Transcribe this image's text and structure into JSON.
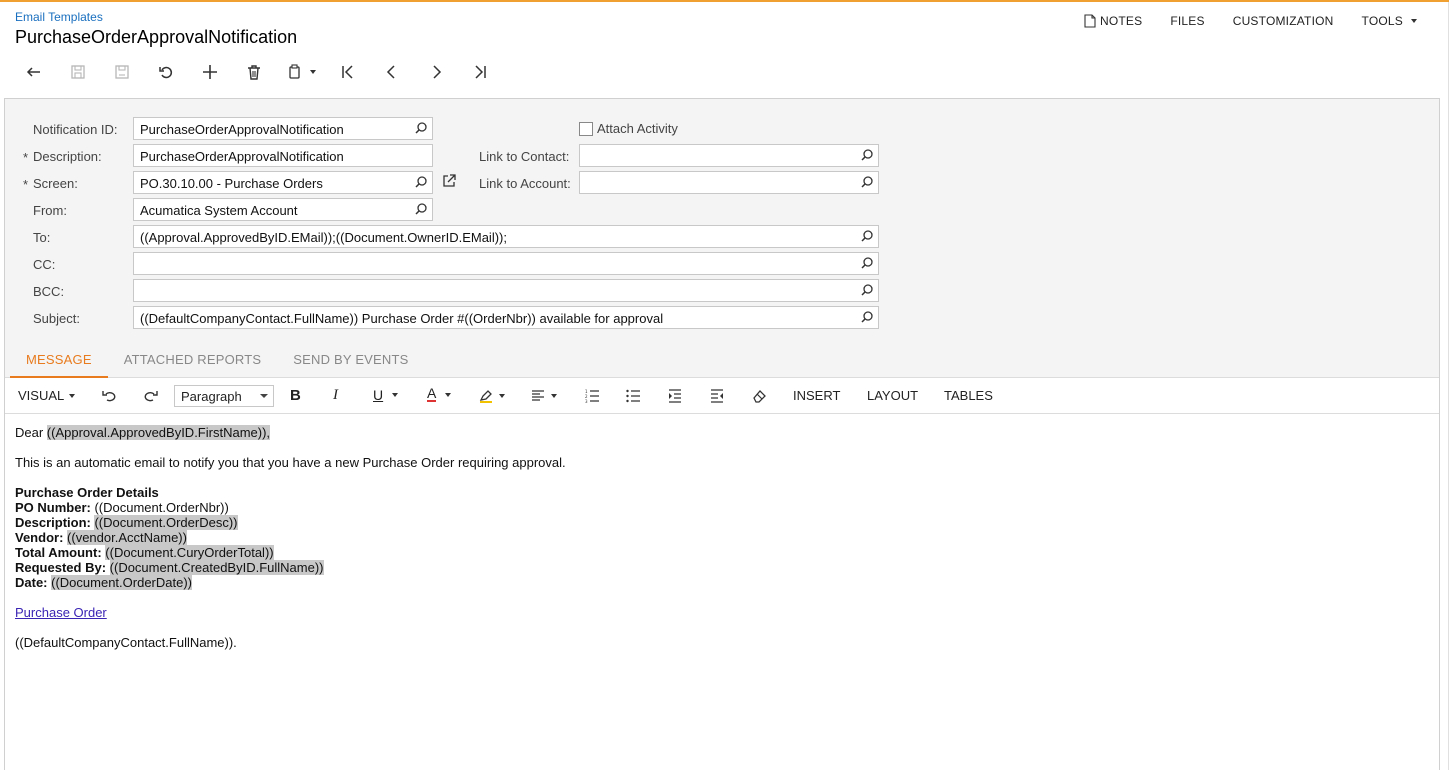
{
  "breadcrumb": "Email Templates",
  "page_title": "PurchaseOrderApprovalNotification",
  "top_menu": {
    "notes": "NOTES",
    "files": "FILES",
    "customization": "CUSTOMIZATION",
    "tools": "TOOLS"
  },
  "toolbar_icons": [
    "back-icon",
    "save-close-icon",
    "save-icon",
    "undo-icon",
    "add-icon",
    "delete-icon",
    "copy-paste-icon",
    "first-record-icon",
    "prev-record-icon",
    "next-record-icon",
    "last-record-icon"
  ],
  "form": {
    "notification_id": {
      "label": "Notification ID:",
      "value": "PurchaseOrderApprovalNotification"
    },
    "description": {
      "label": "Description:",
      "value": "PurchaseOrderApprovalNotification"
    },
    "screen": {
      "label": "Screen:",
      "value": "PO.30.10.00 - Purchase Orders"
    },
    "from": {
      "label": "From:",
      "value": "Acumatica System Account"
    },
    "to": {
      "label": "To:",
      "value": "((Approval.ApprovedByID.EMail));((Document.OwnerID.EMail));"
    },
    "cc": {
      "label": "CC:",
      "value": ""
    },
    "bcc": {
      "label": "BCC:",
      "value": ""
    },
    "subject": {
      "label": "Subject:",
      "value": "((DefaultCompanyContact.FullName)) Purchase Order #((OrderNbr)) available for approval"
    },
    "attach_activity": {
      "label": "Attach Activity",
      "checked": false
    },
    "link_to_contact": {
      "label": "Link to Contact:",
      "value": ""
    },
    "link_to_account": {
      "label": "Link to Account:",
      "value": ""
    },
    "required_mark": "*"
  },
  "tabs": [
    {
      "label": "MESSAGE",
      "active": true
    },
    {
      "label": "ATTACHED REPORTS",
      "active": false
    },
    {
      "label": "SEND BY EVENTS",
      "active": false
    }
  ],
  "editor_toolbar": {
    "mode": "VISUAL",
    "paragraph": "Paragraph",
    "bold": "B",
    "italic": "I",
    "underline": "U",
    "font_color": "A",
    "insert": "INSERT",
    "layout": "LAYOUT",
    "tables": "TABLES"
  },
  "message": {
    "greeting": "Dear ",
    "greeting_field": "((Approval.ApprovedByID.FirstName)),",
    "intro": "This is an automatic email to notify you that you have a new Purchase Order requiring approval.",
    "details_heading": "Purchase Order Details",
    "details": [
      {
        "label": "PO Number:",
        "value": "((Document.OrderNbr))",
        "highlight": false
      },
      {
        "label": "Description:",
        "value": "((Document.OrderDesc))",
        "highlight": true
      },
      {
        "label": "Vendor:",
        "value": "((vendor.AcctName))",
        "highlight": true
      },
      {
        "label": "Total Amount:",
        "value": "((Document.CuryOrderTotal))",
        "highlight": true
      },
      {
        "label": "Requested By:",
        "value": "((Document.CreatedByID.FullName))",
        "highlight": true
      },
      {
        "label": "Date:",
        "value": "((Document.OrderDate))",
        "highlight": true
      }
    ],
    "link_text": "Purchase Order",
    "signature": "((DefaultCompanyContact.FullName))."
  },
  "colors": {
    "accent": "#e87b1e",
    "link": "#1a6fbf",
    "highlight": "#c8c8c8",
    "form_bg": "#f4f4f4"
  }
}
